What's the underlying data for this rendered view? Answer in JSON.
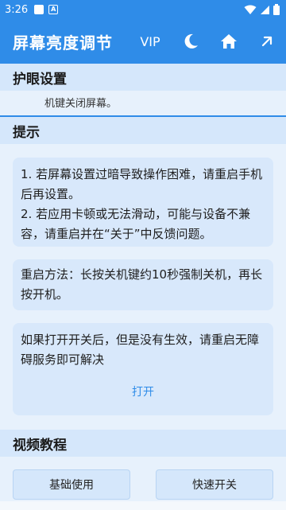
{
  "status_bar": {
    "time": "3:26",
    "notif_a": "A"
  },
  "app_bar": {
    "title": "屏幕亮度调节",
    "vip": "VIP"
  },
  "eye_protect": {
    "title": "护眼设置",
    "subtitle": "机键关闭屏幕。"
  },
  "tips": {
    "title": "提示",
    "card1": {
      "line1": "1. 若屏幕设置过暗导致操作困难，请重启手机后再设置。",
      "line2": "2. 若应用卡顿或无法滑动，可能与设备不兼容，请重启并在“关于”中反馈问题。"
    },
    "card2": "重启方法：长按关机键约10秒强制关机，再长按开机。",
    "card3": {
      "text": "如果打开开关后，但是没有生效，请重启无障碍服务即可解决",
      "link": "打开"
    }
  },
  "tutorial": {
    "title": "视频教程",
    "basic": "基础使用",
    "quick": "快速开关"
  },
  "colors": {
    "primary": "#2f8ce8",
    "background": "#e7f1fc",
    "card": "#d8e8fb"
  }
}
